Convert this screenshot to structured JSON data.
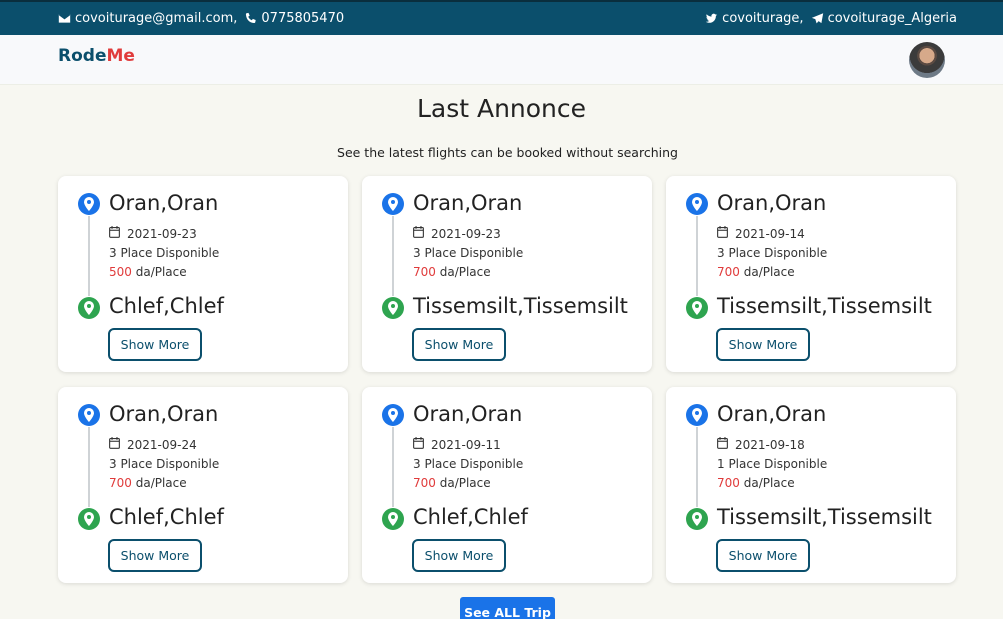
{
  "topbar": {
    "email": "covoiturage@gmail.com,",
    "phone": "0775805470",
    "twitter": "covoiturage,",
    "telegram": "covoiturage_Algeria"
  },
  "brand": {
    "part1": "Rode",
    "part2": "Me"
  },
  "section": {
    "title": "Last Annonce",
    "subtitle": "See the latest flights can be booked without searching"
  },
  "trips": [
    {
      "from": "Oran,Oran",
      "date": "2021-09-23",
      "places": "3 Place Disponible",
      "price": "500",
      "price_unit": " da/Place",
      "to": "Chlef,Chlef",
      "button": "Show More"
    },
    {
      "from": "Oran,Oran",
      "date": "2021-09-23",
      "places": "3 Place Disponible",
      "price": "700",
      "price_unit": " da/Place",
      "to": "Tissemsilt,Tissemsilt",
      "button": "Show More"
    },
    {
      "from": "Oran,Oran",
      "date": "2021-09-14",
      "places": "3 Place Disponible",
      "price": "700",
      "price_unit": " da/Place",
      "to": "Tissemsilt,Tissemsilt",
      "button": "Show More"
    },
    {
      "from": "Oran,Oran",
      "date": "2021-09-24",
      "places": "3 Place Disponible",
      "price": "700",
      "price_unit": " da/Place",
      "to": "Chlef,Chlef",
      "button": "Show More"
    },
    {
      "from": "Oran,Oran",
      "date": "2021-09-11",
      "places": "3 Place Disponible",
      "price": "700",
      "price_unit": " da/Place",
      "to": "Chlef,Chlef",
      "button": "Show More"
    },
    {
      "from": "Oran,Oran",
      "date": "2021-09-18",
      "places": "1 Place Disponible",
      "price": "700",
      "price_unit": " da/Place",
      "to": "Tissemsilt,Tissemsilt",
      "button": "Show More"
    }
  ],
  "see_all": "See ALL Trip",
  "colors": {
    "primary": "#0b4f6c",
    "accent_red": "#e03b3b",
    "pin_from": "#1a73e8",
    "pin_to": "#2ea44f",
    "page_bg": "#f7f7f1"
  },
  "icons": [
    "envelope-icon",
    "phone-icon",
    "twitter-icon",
    "telegram-icon",
    "map-pin-icon",
    "calendar-icon"
  ]
}
